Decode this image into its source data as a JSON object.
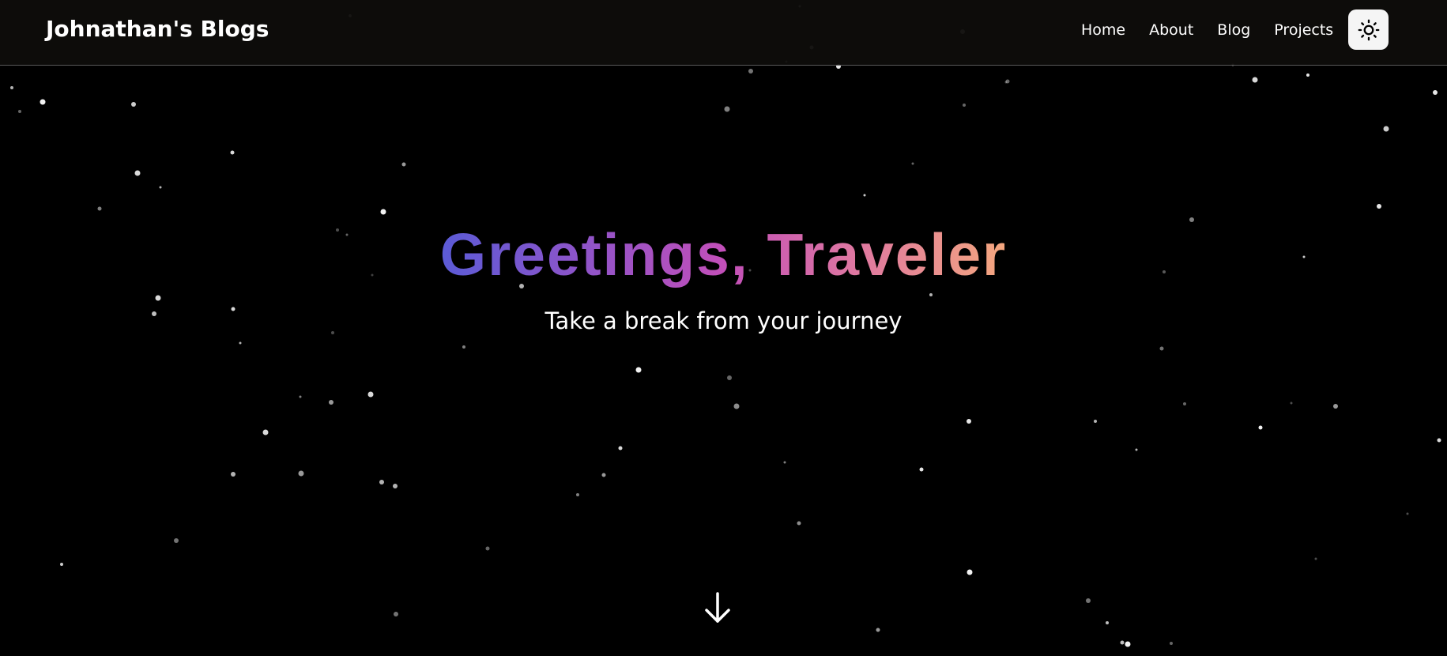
{
  "header": {
    "brand": "Johnathan's Blogs",
    "nav": [
      {
        "label": "Home"
      },
      {
        "label": "About"
      },
      {
        "label": "Blog"
      },
      {
        "label": "Projects"
      }
    ],
    "theme_toggle_icon": "sun-icon"
  },
  "hero": {
    "title": "Greetings, Traveler",
    "subtitle": "Take a break from your journey",
    "scroll_icon": "arrow-down-icon"
  },
  "colors": {
    "background": "#000000",
    "navbar": "#0e0d0b",
    "gradient_start": "#5b5bd6",
    "gradient_mid": "#c24fb9",
    "gradient_end": "#f4a77e",
    "star": "#ffffff"
  }
}
